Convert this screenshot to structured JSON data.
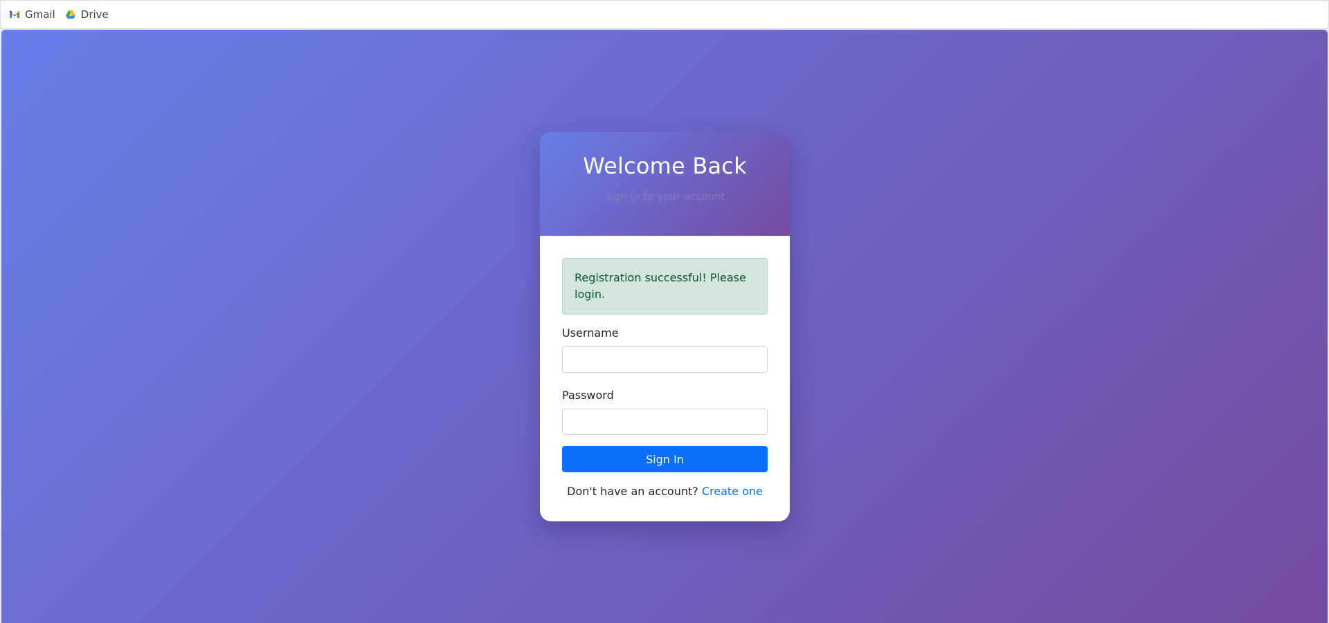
{
  "bookmarks": [
    {
      "label": "Gmail",
      "icon": "gmail-icon"
    },
    {
      "label": "Drive",
      "icon": "google-drive-icon"
    }
  ],
  "login": {
    "title": "Welcome Back",
    "subtitle": "Sign in to your account",
    "alert_message": "Registration successful! Please login.",
    "username_label": "Username",
    "username_value": "",
    "password_label": "Password",
    "password_value": "",
    "submit_label": "Sign In",
    "footer_prompt": "Don't have an account?",
    "footer_link": "Create one"
  },
  "colors": {
    "gradient_start": "#667eea",
    "gradient_end": "#764ba2",
    "primary": "#0d6efd",
    "alert_bg": "#d1e7dd",
    "alert_text": "#0f5132"
  }
}
